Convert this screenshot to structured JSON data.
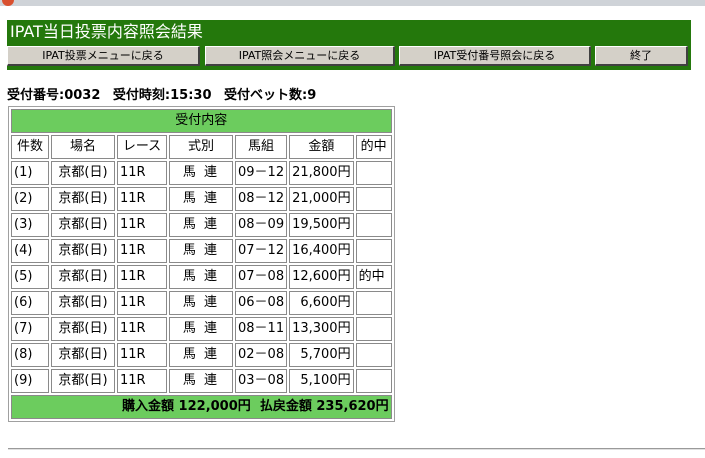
{
  "page": {
    "title": "IPAT当日投票内容照会結果"
  },
  "nav": {
    "buttons": [
      {
        "label": "IPAT投票メニューに戻る"
      },
      {
        "label": "IPAT照会メニューに戻る"
      },
      {
        "label": "IPAT受付番号照会に戻る"
      },
      {
        "label": "終了"
      }
    ]
  },
  "summary": {
    "receipt_no": "受付番号:0032",
    "receipt_time": "受付時刻:15:30",
    "bet_count": "受付ベット数:9"
  },
  "table": {
    "caption": "受付内容",
    "headers": [
      "件数",
      "場名",
      "レース",
      "式別",
      "馬組",
      "金額",
      "的中"
    ],
    "rows": [
      {
        "no": "(1)",
        "venue": "京都(日)",
        "race": "11R",
        "type": "馬 連",
        "combo": "09－12",
        "amount": "21,800円",
        "hit": ""
      },
      {
        "no": "(2)",
        "venue": "京都(日)",
        "race": "11R",
        "type": "馬 連",
        "combo": "08－12",
        "amount": "21,000円",
        "hit": ""
      },
      {
        "no": "(3)",
        "venue": "京都(日)",
        "race": "11R",
        "type": "馬 連",
        "combo": "08－09",
        "amount": "19,500円",
        "hit": ""
      },
      {
        "no": "(4)",
        "venue": "京都(日)",
        "race": "11R",
        "type": "馬 連",
        "combo": "07－12",
        "amount": "16,400円",
        "hit": ""
      },
      {
        "no": "(5)",
        "venue": "京都(日)",
        "race": "11R",
        "type": "馬 連",
        "combo": "07－08",
        "amount": "12,600円",
        "hit": "的中"
      },
      {
        "no": "(6)",
        "venue": "京都(日)",
        "race": "11R",
        "type": "馬 連",
        "combo": "06－08",
        "amount": "6,600円",
        "hit": ""
      },
      {
        "no": "(7)",
        "venue": "京都(日)",
        "race": "11R",
        "type": "馬 連",
        "combo": "08－11",
        "amount": "13,300円",
        "hit": ""
      },
      {
        "no": "(8)",
        "venue": "京都(日)",
        "race": "11R",
        "type": "馬 連",
        "combo": "02－08",
        "amount": "5,700円",
        "hit": ""
      },
      {
        "no": "(9)",
        "venue": "京都(日)",
        "race": "11R",
        "type": "馬 連",
        "combo": "03－08",
        "amount": "5,100円",
        "hit": ""
      }
    ],
    "totals": {
      "purchase": "購入金額 122,000円",
      "payout": "払戻金額 235,620円"
    }
  },
  "colors": {
    "brand_green": "#24780c",
    "table_green": "#6ccc5e",
    "button_face": "#d4d0c8"
  }
}
